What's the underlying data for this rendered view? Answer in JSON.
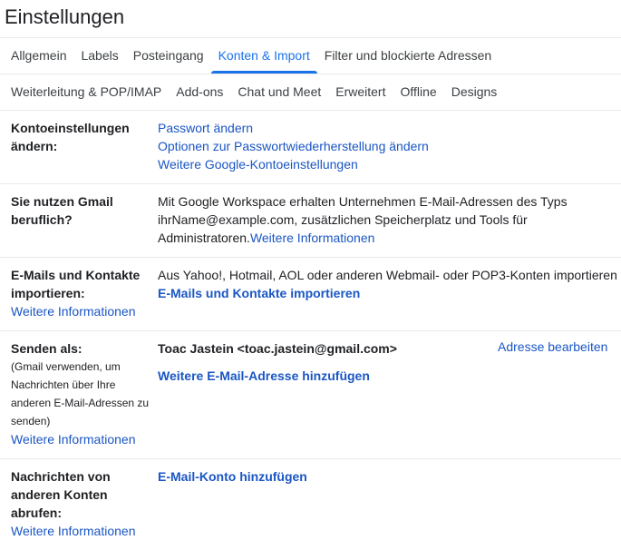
{
  "header": {
    "title": "Einstellungen"
  },
  "tabs_row1": [
    {
      "label": "Allgemein"
    },
    {
      "label": "Labels"
    },
    {
      "label": "Posteingang"
    },
    {
      "label": "Konten & Import",
      "active": true
    },
    {
      "label": "Filter und blockierte Adressen"
    }
  ],
  "tabs_row2": [
    {
      "label": "Weiterleitung & POP/IMAP"
    },
    {
      "label": "Add-ons"
    },
    {
      "label": "Chat und Meet"
    },
    {
      "label": "Erweitert"
    },
    {
      "label": "Offline"
    },
    {
      "label": "Designs"
    }
  ],
  "sections": {
    "account": {
      "label_l1": "Kontoeinstellungen",
      "label_l2": "ändern:",
      "link1": "Passwort ändern",
      "link2": "Optionen zur Passwortwiederherstellung ändern",
      "link3": "Weitere Google-Kontoeinstellungen"
    },
    "workspace": {
      "label_l1": "Sie nutzen Gmail",
      "label_l2": "beruflich?",
      "text1": "Mit Google Workspace erhalten Unternehmen E-Mail-Adressen des Typs",
      "text2": "ihrName@example.com, zusätzlichen Speicherplatz und Tools für",
      "text3": "Administratoren.",
      "more": "Weitere Informationen"
    },
    "import": {
      "label_l1": "E-Mails und Kontakte",
      "label_l2": "importieren:",
      "more": "Weitere Informationen",
      "text": "Aus Yahoo!, Hotmail, AOL oder anderen Webmail- oder POP3-Konten importieren",
      "action": "E-Mails und Kontakte importieren"
    },
    "send_as": {
      "label": "Senden als:",
      "sub1": "(Gmail verwenden, um",
      "sub2": "Nachrichten über Ihre",
      "sub3": "anderen E-Mail-Adressen zu",
      "sub4": "senden)",
      "more": "Weitere Informationen",
      "identity": "Toac Jastein <toac.jastein@gmail.com>",
      "edit": "Adresse bearbeiten",
      "add": "Weitere E-Mail-Adresse hinzufügen"
    },
    "fetch": {
      "label_l1": "Nachrichten von",
      "label_l2": "anderen Konten abrufen:",
      "more": "Weitere Informationen",
      "add": "E-Mail-Konto hinzufügen"
    }
  }
}
